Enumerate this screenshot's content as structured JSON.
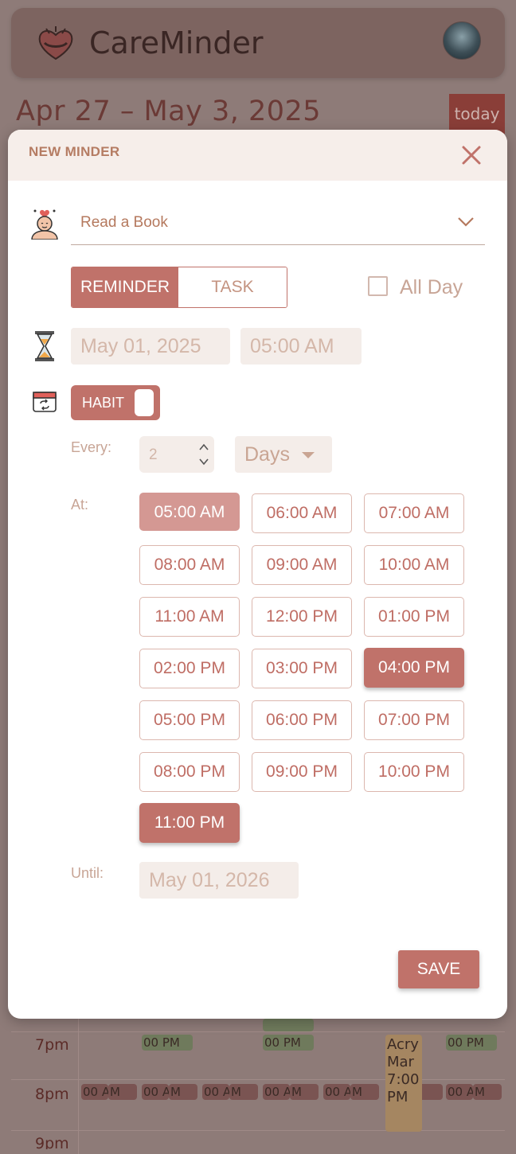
{
  "app": {
    "title": "CareMinder"
  },
  "calendar": {
    "week_range": "Apr 27 – May 3, 2025",
    "today_label": "today",
    "hours": [
      "7pm",
      "8pm",
      "9pm"
    ],
    "events_7pm": [
      "00 PM",
      "00 PM",
      "00 PM"
    ],
    "events_8pm": [
      "00 AM",
      "M",
      "00 AM",
      "M",
      "00 AM",
      "M",
      "00 AM",
      "M",
      "00 AM",
      "M",
      "AM",
      "00 AM",
      "M"
    ],
    "tan_event": "Acry Mar 7:00 PM"
  },
  "modal": {
    "title": "NEW MINDER",
    "minder_select": {
      "value": "Read a Book"
    },
    "type_toggle": {
      "reminder": "REMINDER",
      "task": "TASK",
      "selected": "REMINDER"
    },
    "all_day": {
      "label": "All Day",
      "checked": false
    },
    "start_date": "May 01, 2025",
    "start_time": "05:00 AM",
    "habit": {
      "label": "HABIT",
      "on": true
    },
    "every_label": "Every:",
    "every_value": "2",
    "every_unit": "Days",
    "at_label": "At:",
    "times": [
      {
        "label": "05:00 AM",
        "state": "sel-light"
      },
      {
        "label": "06:00 AM",
        "state": ""
      },
      {
        "label": "07:00 AM",
        "state": ""
      },
      {
        "label": "08:00 AM",
        "state": ""
      },
      {
        "label": "09:00 AM",
        "state": ""
      },
      {
        "label": "10:00 AM",
        "state": ""
      },
      {
        "label": "11:00 AM",
        "state": ""
      },
      {
        "label": "12:00 PM",
        "state": ""
      },
      {
        "label": "01:00 PM",
        "state": ""
      },
      {
        "label": "02:00 PM",
        "state": ""
      },
      {
        "label": "03:00 PM",
        "state": ""
      },
      {
        "label": "04:00 PM",
        "state": "sel-dark"
      },
      {
        "label": "05:00 PM",
        "state": ""
      },
      {
        "label": "06:00 PM",
        "state": ""
      },
      {
        "label": "07:00 PM",
        "state": ""
      },
      {
        "label": "08:00 PM",
        "state": ""
      },
      {
        "label": "09:00 PM",
        "state": ""
      },
      {
        "label": "10:00 PM",
        "state": ""
      },
      {
        "label": "11:00 PM",
        "state": "sel-dark"
      }
    ],
    "until_label": "Until:",
    "until_date": "May 01, 2026",
    "save_label": "SAVE"
  },
  "colors": {
    "accent": "#c0726a",
    "accent_light": "#d49893",
    "header_bg": "#f6eeea",
    "field_bg": "#f4ede9"
  },
  "icons": [
    "heart-hug-logo-icon",
    "user-avatar",
    "close-icon",
    "self-care-person-icon",
    "chevron-down-icon",
    "hourglass-icon",
    "calendar-repeat-icon",
    "caret-down-icon",
    "stepper-up-icon",
    "stepper-down-icon"
  ]
}
